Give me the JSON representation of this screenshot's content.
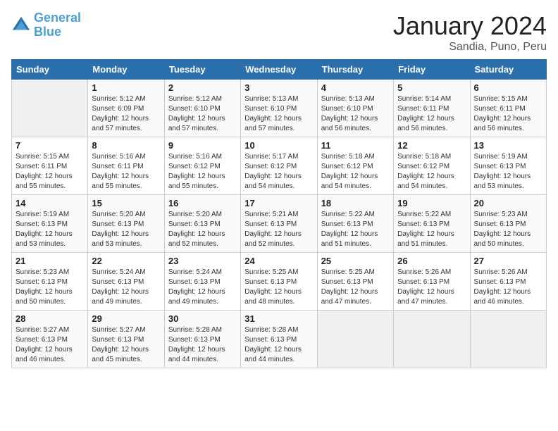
{
  "header": {
    "logo_line1": "General",
    "logo_line2": "Blue",
    "title": "January 2024",
    "subtitle": "Sandia, Puno, Peru"
  },
  "columns": [
    "Sunday",
    "Monday",
    "Tuesday",
    "Wednesday",
    "Thursday",
    "Friday",
    "Saturday"
  ],
  "weeks": [
    [
      {
        "day": "",
        "info": ""
      },
      {
        "day": "1",
        "info": "Sunrise: 5:12 AM\nSunset: 6:09 PM\nDaylight: 12 hours\nand 57 minutes."
      },
      {
        "day": "2",
        "info": "Sunrise: 5:12 AM\nSunset: 6:10 PM\nDaylight: 12 hours\nand 57 minutes."
      },
      {
        "day": "3",
        "info": "Sunrise: 5:13 AM\nSunset: 6:10 PM\nDaylight: 12 hours\nand 57 minutes."
      },
      {
        "day": "4",
        "info": "Sunrise: 5:13 AM\nSunset: 6:10 PM\nDaylight: 12 hours\nand 56 minutes."
      },
      {
        "day": "5",
        "info": "Sunrise: 5:14 AM\nSunset: 6:11 PM\nDaylight: 12 hours\nand 56 minutes."
      },
      {
        "day": "6",
        "info": "Sunrise: 5:15 AM\nSunset: 6:11 PM\nDaylight: 12 hours\nand 56 minutes."
      }
    ],
    [
      {
        "day": "7",
        "info": "Sunrise: 5:15 AM\nSunset: 6:11 PM\nDaylight: 12 hours\nand 55 minutes."
      },
      {
        "day": "8",
        "info": "Sunrise: 5:16 AM\nSunset: 6:11 PM\nDaylight: 12 hours\nand 55 minutes."
      },
      {
        "day": "9",
        "info": "Sunrise: 5:16 AM\nSunset: 6:12 PM\nDaylight: 12 hours\nand 55 minutes."
      },
      {
        "day": "10",
        "info": "Sunrise: 5:17 AM\nSunset: 6:12 PM\nDaylight: 12 hours\nand 54 minutes."
      },
      {
        "day": "11",
        "info": "Sunrise: 5:18 AM\nSunset: 6:12 PM\nDaylight: 12 hours\nand 54 minutes."
      },
      {
        "day": "12",
        "info": "Sunrise: 5:18 AM\nSunset: 6:12 PM\nDaylight: 12 hours\nand 54 minutes."
      },
      {
        "day": "13",
        "info": "Sunrise: 5:19 AM\nSunset: 6:13 PM\nDaylight: 12 hours\nand 53 minutes."
      }
    ],
    [
      {
        "day": "14",
        "info": "Sunrise: 5:19 AM\nSunset: 6:13 PM\nDaylight: 12 hours\nand 53 minutes."
      },
      {
        "day": "15",
        "info": "Sunrise: 5:20 AM\nSunset: 6:13 PM\nDaylight: 12 hours\nand 53 minutes."
      },
      {
        "day": "16",
        "info": "Sunrise: 5:20 AM\nSunset: 6:13 PM\nDaylight: 12 hours\nand 52 minutes."
      },
      {
        "day": "17",
        "info": "Sunrise: 5:21 AM\nSunset: 6:13 PM\nDaylight: 12 hours\nand 52 minutes."
      },
      {
        "day": "18",
        "info": "Sunrise: 5:22 AM\nSunset: 6:13 PM\nDaylight: 12 hours\nand 51 minutes."
      },
      {
        "day": "19",
        "info": "Sunrise: 5:22 AM\nSunset: 6:13 PM\nDaylight: 12 hours\nand 51 minutes."
      },
      {
        "day": "20",
        "info": "Sunrise: 5:23 AM\nSunset: 6:13 PM\nDaylight: 12 hours\nand 50 minutes."
      }
    ],
    [
      {
        "day": "21",
        "info": "Sunrise: 5:23 AM\nSunset: 6:13 PM\nDaylight: 12 hours\nand 50 minutes."
      },
      {
        "day": "22",
        "info": "Sunrise: 5:24 AM\nSunset: 6:13 PM\nDaylight: 12 hours\nand 49 minutes."
      },
      {
        "day": "23",
        "info": "Sunrise: 5:24 AM\nSunset: 6:13 PM\nDaylight: 12 hours\nand 49 minutes."
      },
      {
        "day": "24",
        "info": "Sunrise: 5:25 AM\nSunset: 6:13 PM\nDaylight: 12 hours\nand 48 minutes."
      },
      {
        "day": "25",
        "info": "Sunrise: 5:25 AM\nSunset: 6:13 PM\nDaylight: 12 hours\nand 47 minutes."
      },
      {
        "day": "26",
        "info": "Sunrise: 5:26 AM\nSunset: 6:13 PM\nDaylight: 12 hours\nand 47 minutes."
      },
      {
        "day": "27",
        "info": "Sunrise: 5:26 AM\nSunset: 6:13 PM\nDaylight: 12 hours\nand 46 minutes."
      }
    ],
    [
      {
        "day": "28",
        "info": "Sunrise: 5:27 AM\nSunset: 6:13 PM\nDaylight: 12 hours\nand 46 minutes."
      },
      {
        "day": "29",
        "info": "Sunrise: 5:27 AM\nSunset: 6:13 PM\nDaylight: 12 hours\nand 45 minutes."
      },
      {
        "day": "30",
        "info": "Sunrise: 5:28 AM\nSunset: 6:13 PM\nDaylight: 12 hours\nand 44 minutes."
      },
      {
        "day": "31",
        "info": "Sunrise: 5:28 AM\nSunset: 6:13 PM\nDaylight: 12 hours\nand 44 minutes."
      },
      {
        "day": "",
        "info": ""
      },
      {
        "day": "",
        "info": ""
      },
      {
        "day": "",
        "info": ""
      }
    ]
  ]
}
